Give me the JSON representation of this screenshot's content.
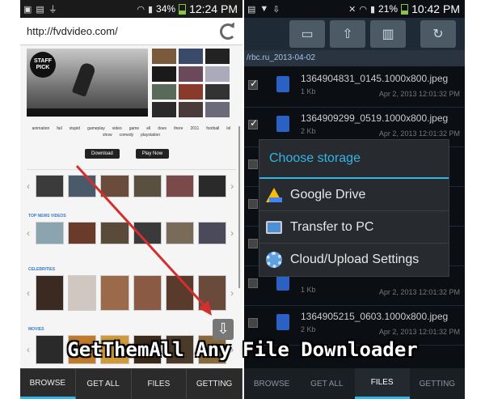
{
  "left": {
    "status": {
      "battery": "34%",
      "time": "12:24 PM"
    },
    "url": "http://fvdvideo.com/",
    "hero_badge": "STAFF PICK",
    "tags": [
      "animation",
      "fail",
      "stupid",
      "gameplay",
      "video",
      "game",
      "ell",
      "does",
      "there",
      "2011",
      "football",
      "lol",
      "show",
      "comedy",
      "playstation"
    ],
    "buttons": {
      "download": "Download",
      "play_now": "Play Now"
    },
    "sections": {
      "top_news": "TOP NEWS VIDEOS",
      "celebrities": "CELEBRITIES",
      "movies": "MOVIES"
    },
    "bottom_tabs": [
      "BROWSE",
      "GET ALL",
      "FILES",
      "GETTING"
    ],
    "active_tab": "BROWSE"
  },
  "right": {
    "status": {
      "battery": "21%",
      "time": "10:42 PM"
    },
    "path": "/rbc.ru_2013-04-02",
    "files": [
      {
        "name": "1364904831_0145.1000x800.jpeg",
        "size": "1 Kb",
        "date": "Apr 2, 2013 12:01:32 PM",
        "checked": true
      },
      {
        "name": "1364909299_0519.1000x800.jpeg",
        "size": "2 Kb",
        "date": "Apr 2, 2013 12:01:32 PM",
        "checked": true
      },
      {
        "name": "",
        "size": "",
        "date": "",
        "checked": false
      },
      {
        "name": "",
        "size": "",
        "date": "",
        "checked": false
      },
      {
        "name": "",
        "size": "",
        "date": "",
        "checked": false
      },
      {
        "name": "",
        "size": "1 Kb",
        "date": "Apr 2, 2013 12:01:32 PM",
        "checked": false
      },
      {
        "name": "1364905215_0603.1000x800.jpeg",
        "size": "2 Kb",
        "date": "Apr 2, 2013 12:01:32 PM",
        "checked": false
      },
      {
        "name": "",
        "size": "",
        "date": "",
        "checked": false
      }
    ],
    "dialog": {
      "title": "Choose storage",
      "options": [
        "Google Drive",
        "Transfer to PC",
        "Cloud/Upload Settings"
      ]
    },
    "bottom_tabs": [
      "BROWSE",
      "GET ALL",
      "FILES",
      "GETTING"
    ],
    "active_tab": "FILES"
  },
  "caption": "GetThemAll Any File Downloader",
  "colors": {
    "accent": "#33b5e5",
    "arrow": "#d32f2f"
  }
}
